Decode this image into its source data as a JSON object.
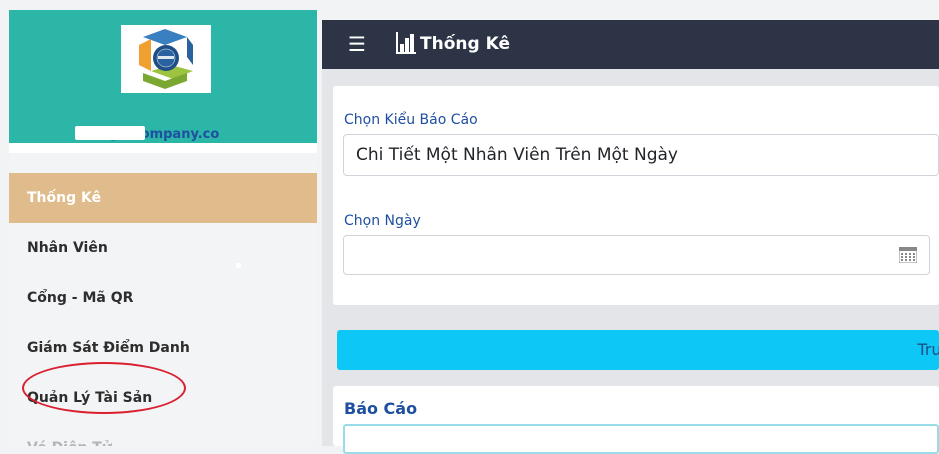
{
  "sidebar": {
    "email": "@lecompany.co",
    "items": [
      {
        "label": "Thống Kê",
        "state": "active"
      },
      {
        "label": "Nhân Viên",
        "state": "normal"
      },
      {
        "label": "Cổng - Mã QR",
        "state": "normal"
      },
      {
        "label": "Giám Sát Điểm Danh",
        "state": "normal"
      },
      {
        "label": "Quản Lý Tài Sản",
        "state": "normal"
      },
      {
        "label": "Vé Điện Tử",
        "state": "disabled"
      }
    ]
  },
  "header": {
    "menu_icon": "hamburger-icon",
    "title_icon": "bar-chart-icon",
    "title": "Thống Kê"
  },
  "form": {
    "report_type_label": "Chọn Kiểu Báo Cáo",
    "report_type_value": "Chi Tiết Một Nhân Viên Trên Một Ngày",
    "date_label": "Chọn Ngày",
    "date_value": "",
    "date_icon": "calendar-icon",
    "submit_label": "Truy"
  },
  "report": {
    "title": "Báo Cáo"
  },
  "colors": {
    "profile_bg": "#2bb6a8",
    "active_nav": "#e0bc8c",
    "topbar": "#2c3445",
    "button": "#0dc7f6",
    "label": "#1f4fa0",
    "highlight_circle": "#d92030"
  }
}
